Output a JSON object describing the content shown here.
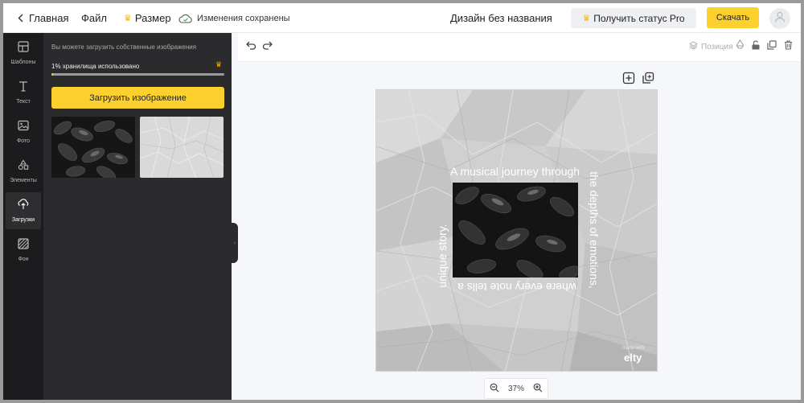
{
  "topbar": {
    "home_label": "Главная",
    "file_label": "Файл",
    "size_label": "Размер",
    "saved_status": "Изменения сохранены",
    "design_title": "Дизайн без названия",
    "pro_label": "Получить статус Pro",
    "download_label": "Скачать"
  },
  "rail": {
    "items": [
      {
        "label": "Шаблоны",
        "icon": "templates-icon"
      },
      {
        "label": "Текст",
        "icon": "text-icon"
      },
      {
        "label": "Фото",
        "icon": "photo-icon"
      },
      {
        "label": "Элементы",
        "icon": "elements-icon"
      },
      {
        "label": "Загрузки",
        "icon": "upload-icon"
      },
      {
        "label": "Фон",
        "icon": "background-icon"
      }
    ],
    "active_index": 4
  },
  "panel": {
    "hint": "Вы можете загрузить собственные изображения",
    "storage_label": "1% хранилища использовано",
    "storage_percent": 1,
    "upload_label": "Загрузить изображение",
    "thumbnails": [
      "dark-leaves-image",
      "crumpled-paper-image"
    ]
  },
  "toolbar": {
    "position_label": "Позиция"
  },
  "artboard": {
    "text_top": "A musical journey through",
    "text_right": "the depths of emotions,",
    "text_bottom": "where every note tells a",
    "text_left": "unique story.",
    "brand_small": "made with",
    "brand_name": "elty"
  },
  "zoom": {
    "value": "37%"
  },
  "colors": {
    "accent": "#fdd12d",
    "rail_bg": "#1c1c1e",
    "panel_bg": "#2b2b2d",
    "workspace_bg": "#f5f7fb"
  }
}
